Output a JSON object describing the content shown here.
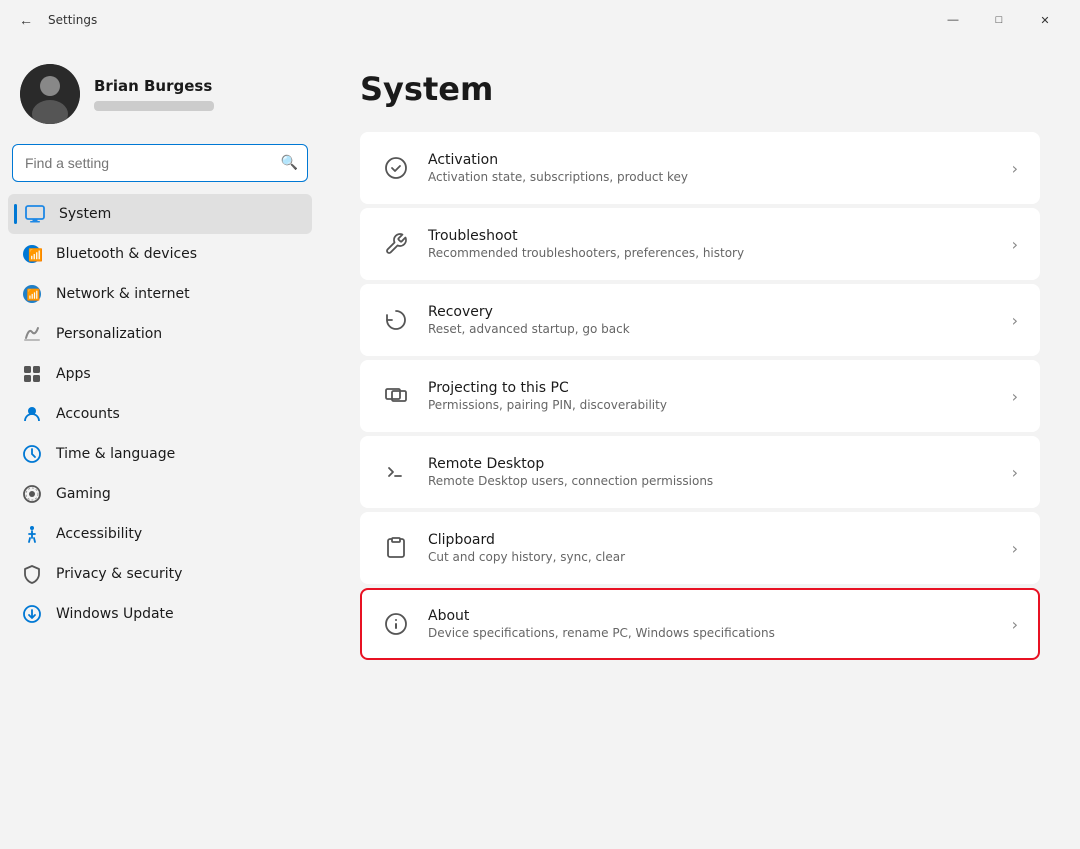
{
  "titlebar": {
    "title": "Settings",
    "minimize": "—",
    "maximize": "□",
    "close": "✕"
  },
  "user": {
    "name": "Brian Burgess"
  },
  "search": {
    "placeholder": "Find a setting"
  },
  "sidebar": {
    "items": [
      {
        "id": "system",
        "label": "System",
        "icon": "system",
        "active": true
      },
      {
        "id": "bluetooth",
        "label": "Bluetooth & devices",
        "icon": "bluetooth",
        "active": false
      },
      {
        "id": "network",
        "label": "Network & internet",
        "icon": "network",
        "active": false
      },
      {
        "id": "personalization",
        "label": "Personalization",
        "icon": "personalization",
        "active": false
      },
      {
        "id": "apps",
        "label": "Apps",
        "icon": "apps",
        "active": false
      },
      {
        "id": "accounts",
        "label": "Accounts",
        "icon": "accounts",
        "active": false
      },
      {
        "id": "time",
        "label": "Time & language",
        "icon": "time",
        "active": false
      },
      {
        "id": "gaming",
        "label": "Gaming",
        "icon": "gaming",
        "active": false
      },
      {
        "id": "accessibility",
        "label": "Accessibility",
        "icon": "accessibility",
        "active": false
      },
      {
        "id": "privacy",
        "label": "Privacy & security",
        "icon": "privacy",
        "active": false
      },
      {
        "id": "update",
        "label": "Windows Update",
        "icon": "update",
        "active": false
      }
    ]
  },
  "main": {
    "title": "System",
    "settings": [
      {
        "id": "activation",
        "title": "Activation",
        "desc": "Activation state, subscriptions, product key"
      },
      {
        "id": "troubleshoot",
        "title": "Troubleshoot",
        "desc": "Recommended troubleshooters, preferences, history"
      },
      {
        "id": "recovery",
        "title": "Recovery",
        "desc": "Reset, advanced startup, go back"
      },
      {
        "id": "projecting",
        "title": "Projecting to this PC",
        "desc": "Permissions, pairing PIN, discoverability"
      },
      {
        "id": "remote-desktop",
        "title": "Remote Desktop",
        "desc": "Remote Desktop users, connection permissions"
      },
      {
        "id": "clipboard",
        "title": "Clipboard",
        "desc": "Cut and copy history, sync, clear"
      },
      {
        "id": "about",
        "title": "About",
        "desc": "Device specifications, rename PC, Windows specifications",
        "highlighted": true
      }
    ]
  }
}
